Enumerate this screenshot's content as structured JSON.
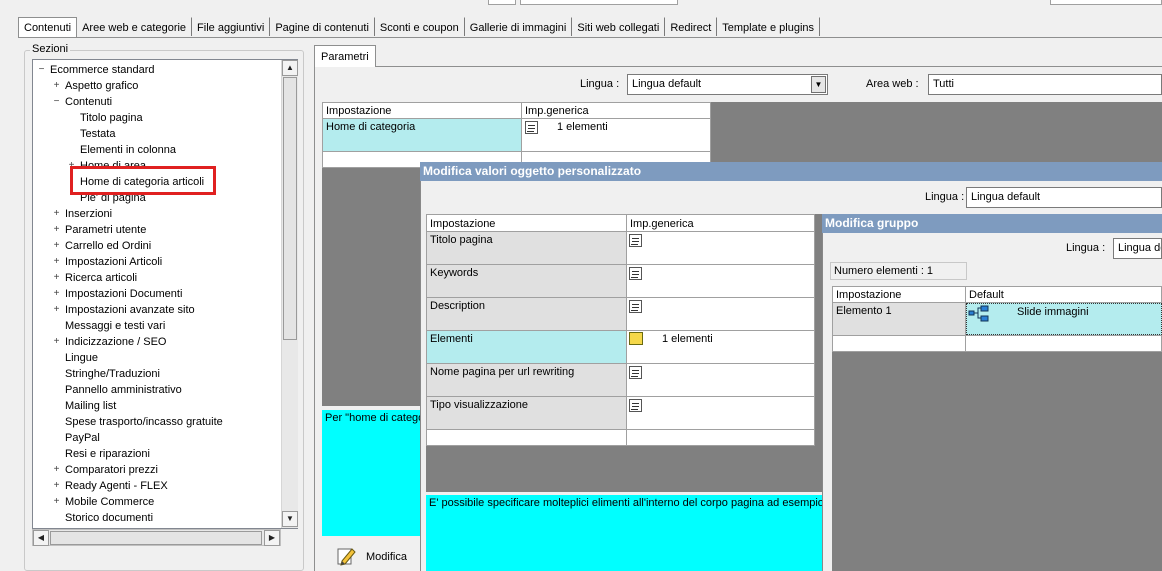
{
  "tabs": [
    "Contenuti",
    "Aree web e categorie",
    "File aggiuntivi",
    "Pagine di contenuti",
    "Sconti e coupon",
    "Gallerie di immagini",
    "Siti web collegati",
    "Redirect",
    "Template e plugins"
  ],
  "sections": {
    "title": "Sezioni",
    "tree": [
      {
        "label": "Ecommerce standard",
        "indent": 0,
        "exp": "minus"
      },
      {
        "label": "Aspetto grafico",
        "indent": 1,
        "exp": "plus"
      },
      {
        "label": "Contenuti",
        "indent": 1,
        "exp": "minus"
      },
      {
        "label": "Titolo pagina",
        "indent": 2,
        "exp": ""
      },
      {
        "label": "Testata",
        "indent": 2,
        "exp": ""
      },
      {
        "label": "Elementi in colonna",
        "indent": 2,
        "exp": ""
      },
      {
        "label": "Home di area",
        "indent": 2,
        "exp": "plus"
      },
      {
        "label": "Home di categoria articoli",
        "indent": 2,
        "exp": "",
        "selected": true
      },
      {
        "label": "Pie' di pagina",
        "indent": 2,
        "exp": ""
      },
      {
        "label": "Inserzioni",
        "indent": 1,
        "exp": "plus"
      },
      {
        "label": "Parametri utente",
        "indent": 1,
        "exp": "plus"
      },
      {
        "label": "Carrello ed Ordini",
        "indent": 1,
        "exp": "plus"
      },
      {
        "label": "Impostazioni Articoli",
        "indent": 1,
        "exp": "plus"
      },
      {
        "label": "Ricerca articoli",
        "indent": 1,
        "exp": "plus"
      },
      {
        "label": "Impostazioni Documenti",
        "indent": 1,
        "exp": "plus"
      },
      {
        "label": "Impostazioni avanzate sito",
        "indent": 1,
        "exp": "plus"
      },
      {
        "label": "Messaggi e testi vari",
        "indent": 1,
        "exp": ""
      },
      {
        "label": "Indicizzazione / SEO",
        "indent": 1,
        "exp": "plus"
      },
      {
        "label": "Lingue",
        "indent": 1,
        "exp": ""
      },
      {
        "label": "Stringhe/Traduzioni",
        "indent": 1,
        "exp": ""
      },
      {
        "label": "Pannello amministrativo",
        "indent": 1,
        "exp": ""
      },
      {
        "label": "Mailing list",
        "indent": 1,
        "exp": ""
      },
      {
        "label": "Spese trasporto/incasso gratuite",
        "indent": 1,
        "exp": ""
      },
      {
        "label": "PayPal",
        "indent": 1,
        "exp": ""
      },
      {
        "label": "Resi e riparazioni",
        "indent": 1,
        "exp": ""
      },
      {
        "label": "Comparatori prezzi",
        "indent": 1,
        "exp": "plus"
      },
      {
        "label": "Ready Agenti - FLEX",
        "indent": 1,
        "exp": "plus"
      },
      {
        "label": "Mobile Commerce",
        "indent": 1,
        "exp": "plus"
      },
      {
        "label": "Storico documenti",
        "indent": 1,
        "exp": ""
      }
    ]
  },
  "params": {
    "tab_label": "Parametri",
    "lingua_label": "Lingua :",
    "lingua_value": "Lingua default",
    "area_label": "Area web :",
    "area_value": "Tutti",
    "col_setting": "Impostazione",
    "col_generic": "Imp.generica",
    "row_name": "Home di categoria",
    "row_value": "1 elementi",
    "desc_text": "Per \"home di catego",
    "modify_label": "Modifica"
  },
  "dialog1": {
    "title": "Modifica valori oggetto personalizzato",
    "lingua_label": "Lingua :",
    "lingua_value": "Lingua default",
    "col_setting": "Impostazione",
    "col_generic": "Imp.generica",
    "rows": [
      {
        "name": "Titolo pagina",
        "value": ""
      },
      {
        "name": "Keywords",
        "value": ""
      },
      {
        "name": "Description",
        "value": ""
      },
      {
        "name": "Elementi",
        "value": "1 elementi"
      },
      {
        "name": "Nome pagina per url rewriting",
        "value": ""
      },
      {
        "name": "Tipo visualizzazione",
        "value": ""
      }
    ],
    "desc_text": "E' possibile specificare molteplici elimenti all'interno del corpo pagina ad esempio un"
  },
  "dialog2": {
    "title": "Modifica gruppo",
    "lingua_label": "Lingua :",
    "lingua_value": "Lingua de",
    "count_label": "Numero elementi : 1",
    "col_setting": "Impostazione",
    "col_default": "Default",
    "row_name": "Elemento 1",
    "row_value": "Slide immagini"
  }
}
